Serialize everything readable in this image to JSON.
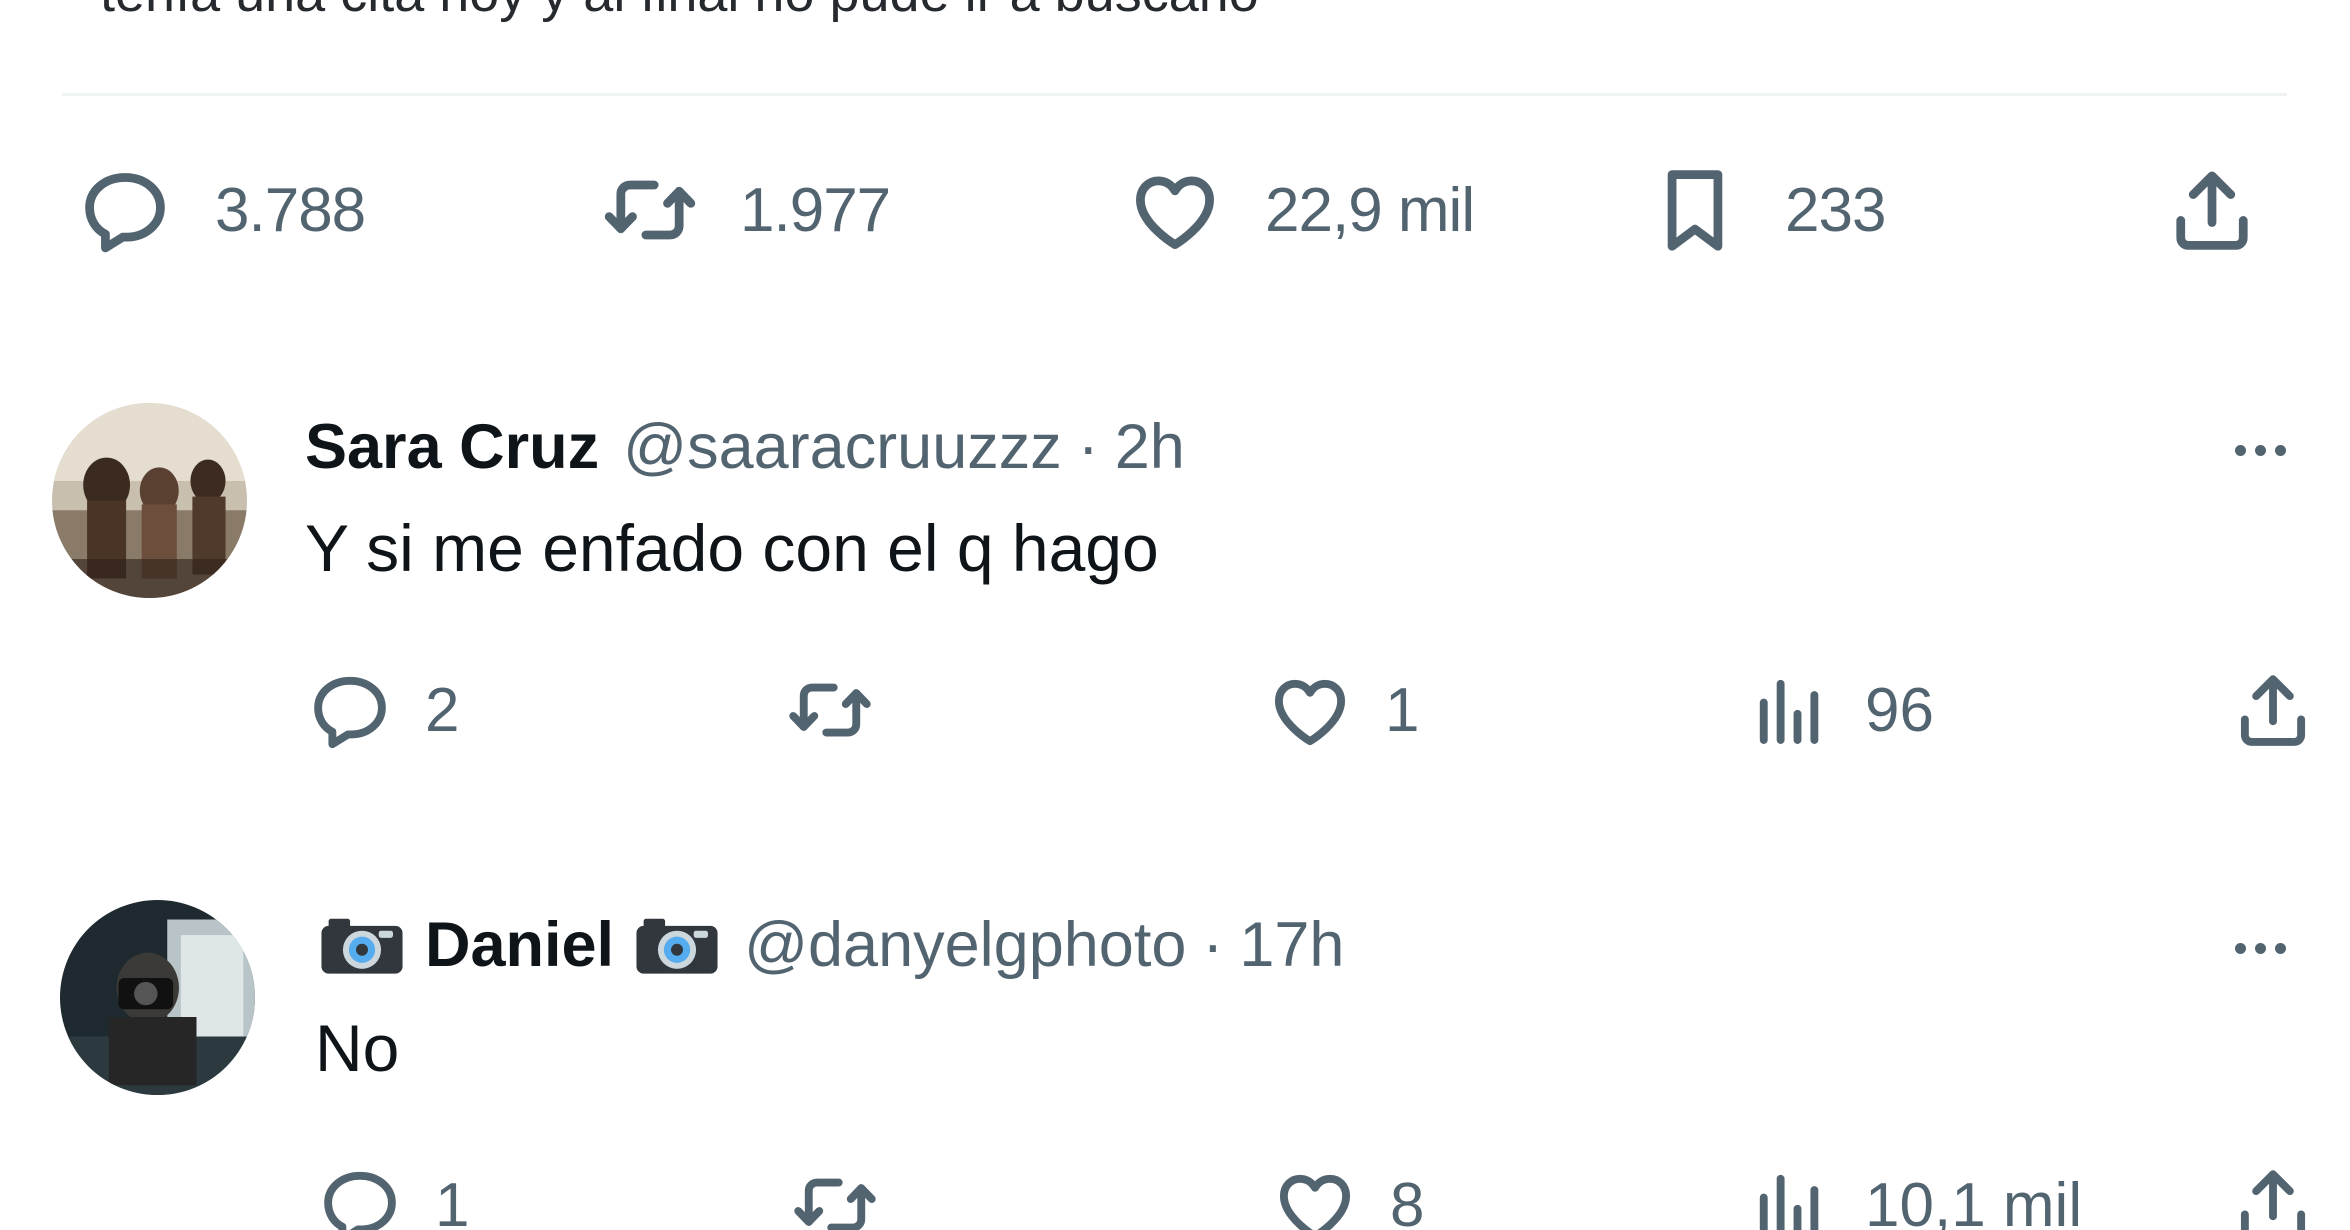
{
  "top_fragment": {
    "text": "tenía una cita hoy y al final no pude ir a buscarlo"
  },
  "main_tweet_actions": {
    "replies": "3.788",
    "retweets": "1.977",
    "likes": "22,9 mil",
    "bookmarks": "233",
    "icons": [
      "reply-icon",
      "retweet-icon",
      "heart-icon",
      "bookmark-icon",
      "share-icon"
    ]
  },
  "replies": [
    {
      "display_name": "Sara Cruz",
      "handle": "@saaracruuzzz",
      "separator": "·",
      "time": "2h",
      "text": "Y si me enfado con el q hago",
      "reply_count": "2",
      "retweet_count": "",
      "like_count": "1",
      "view_count": "96"
    },
    {
      "display_name": "Daniel",
      "name_emoji": "camera-emoji",
      "handle": "@danyelgphoto",
      "separator": "·",
      "time": "17h",
      "text": "No",
      "reply_count": "1",
      "retweet_count": "",
      "like_count": "8",
      "view_count": "10,1 mil"
    }
  ],
  "colors": {
    "text_primary": "#0f1419",
    "text_secondary": "#536471",
    "divider": "#eff3f4",
    "background": "#ffffff"
  }
}
